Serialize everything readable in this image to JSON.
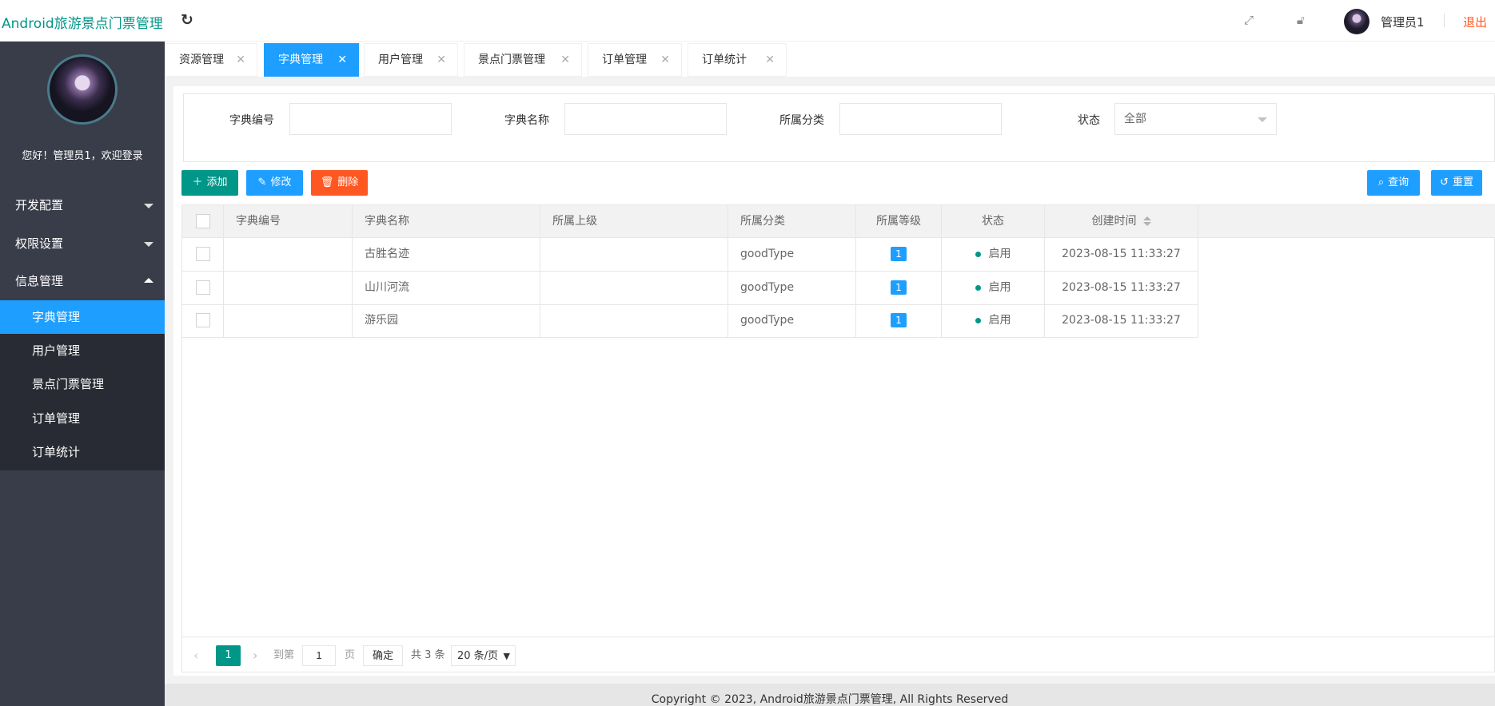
{
  "header": {
    "app_title": "Android旅游景点门票管理",
    "username": "管理员1",
    "logout_label": "退出"
  },
  "sidebar": {
    "welcome": "您好！管理员1，欢迎登录",
    "menus": [
      {
        "label": "开发配置",
        "expanded": false
      },
      {
        "label": "权限设置",
        "expanded": false
      },
      {
        "label": "信息管理",
        "expanded": true
      }
    ],
    "sub_items": [
      {
        "label": "字典管理",
        "active": true
      },
      {
        "label": "用户管理",
        "active": false
      },
      {
        "label": "景点门票管理",
        "active": false
      },
      {
        "label": "订单管理",
        "active": false
      },
      {
        "label": "订单统计",
        "active": false
      }
    ]
  },
  "tabs": [
    {
      "label": "资源管理",
      "active": false
    },
    {
      "label": "字典管理",
      "active": true
    },
    {
      "label": "用户管理",
      "active": false
    },
    {
      "label": "景点门票管理",
      "active": false
    },
    {
      "label": "订单管理",
      "active": false
    },
    {
      "label": "订单统计",
      "active": false
    }
  ],
  "search": {
    "dict_code_label": "字典编号",
    "dict_name_label": "字典名称",
    "category_label": "所属分类",
    "status_label": "状态",
    "status_value": "全部",
    "dict_code_value": "",
    "dict_name_value": "",
    "category_value": ""
  },
  "toolbar": {
    "add_label": "添加",
    "edit_label": "修改",
    "delete_label": "删除",
    "query_label": "查询",
    "reset_label": "重置"
  },
  "table": {
    "columns": [
      "字典编号",
      "字典名称",
      "所属上级",
      "所属分类",
      "所属等级",
      "状态",
      "创建时间"
    ],
    "rows": [
      {
        "code": "",
        "name": "古胜名迹",
        "parent": "",
        "category": "goodType",
        "level": "1",
        "status": "启用",
        "created": "2023-08-15 11:33:27"
      },
      {
        "code": "",
        "name": "山川河流",
        "parent": "",
        "category": "goodType",
        "level": "1",
        "status": "启用",
        "created": "2023-08-15 11:33:27"
      },
      {
        "code": "",
        "name": "游乐园",
        "parent": "",
        "category": "goodType",
        "level": "1",
        "status": "启用",
        "created": "2023-08-15 11:33:27"
      }
    ]
  },
  "pager": {
    "current_page": "1",
    "goto_label": "到第",
    "goto_value": "1",
    "page_suffix": "页",
    "confirm_label": "确定",
    "total_label": "共 3 条",
    "page_size": "20 条/页"
  },
  "footer": {
    "copyright": "Copyright © 2023, Android旅游景点门票管理, All Rights Reserved"
  },
  "colors": {
    "brand": "#009688",
    "accent": "#1e9fff",
    "danger": "#ff5722",
    "sidebar_bg": "#393d49"
  }
}
